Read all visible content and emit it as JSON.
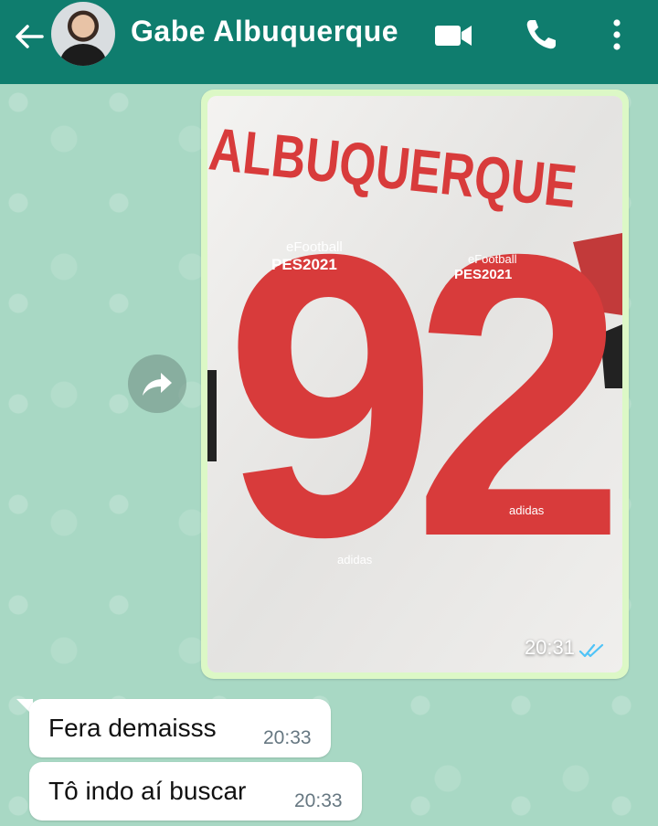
{
  "header": {
    "contact_name": "Gabe Albuquerque",
    "icons": [
      "back-arrow-icon",
      "video-camera-icon",
      "phone-icon",
      "more-vertical-icon"
    ],
    "bg_color": "#0f7d6e"
  },
  "chat": {
    "bg_color": "#a8d8c4",
    "image_message": {
      "time": "20:31",
      "status": "read",
      "tick_color": "#4fc3f7",
      "photo_lettering": {
        "name": "ALBUQUERQUE",
        "number": "92",
        "sponsor": "eFootball",
        "sponsor_sub": "PES2021",
        "brand": "adidas"
      }
    },
    "messages": [
      {
        "text": "Fera demaisss",
        "time": "20:33"
      },
      {
        "text": "Tô indo aí buscar",
        "time": "20:33"
      }
    ]
  }
}
